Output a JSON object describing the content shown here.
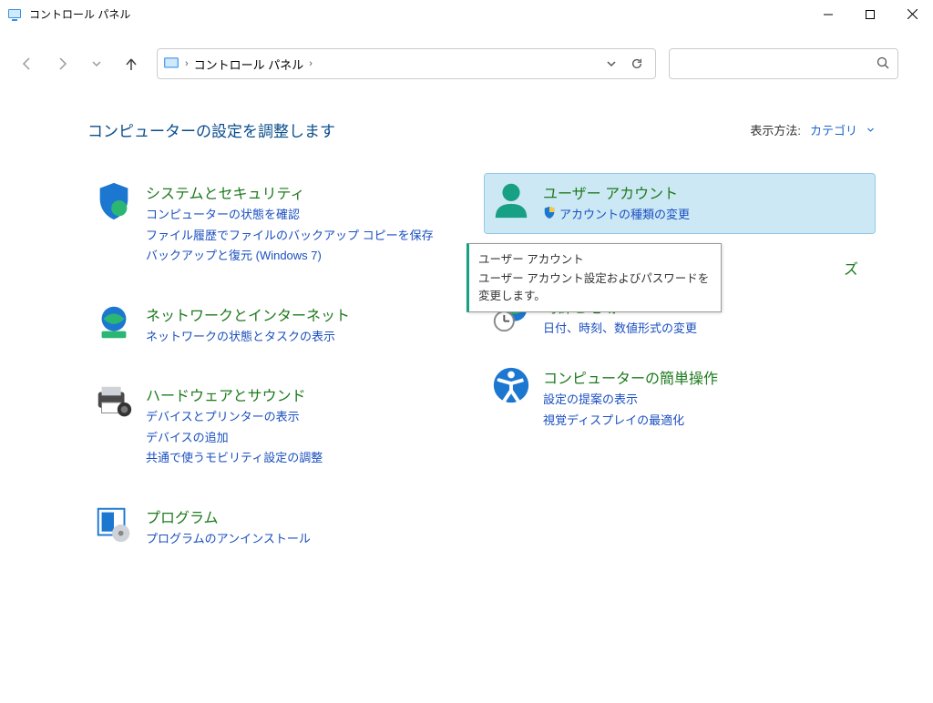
{
  "window": {
    "title": "コントロール パネル"
  },
  "breadcrumb": {
    "root": "コントロール パネル"
  },
  "heading": "コンピューターの設定を調整します",
  "viewby": {
    "label": "表示方法:",
    "value": "カテゴリ"
  },
  "left": [
    {
      "title": "システムとセキュリティ",
      "links": [
        "コンピューターの状態を確認",
        "ファイル履歴でファイルのバックアップ コピーを保存",
        "バックアップと復元 (Windows 7)"
      ]
    },
    {
      "title": "ネットワークとインターネット",
      "links": [
        "ネットワークの状態とタスクの表示"
      ]
    },
    {
      "title": "ハードウェアとサウンド",
      "links": [
        "デバイスとプリンターの表示",
        "デバイスの追加",
        "共通で使うモビリティ設定の調整"
      ]
    },
    {
      "title": "プログラム",
      "links": [
        "プログラムのアンインストール"
      ]
    }
  ],
  "right": [
    {
      "title": "ユーザー アカウント",
      "shield_link": "アカウントの種類の変更"
    },
    {
      "title_trail": "ズ"
    },
    {
      "title": "時計と地域",
      "links": [
        "日付、時刻、数値形式の変更"
      ]
    },
    {
      "title": "コンピューターの簡単操作",
      "links": [
        "設定の提案の表示",
        "視覚ディスプレイの最適化"
      ]
    }
  ],
  "tooltip": {
    "title": "ユーザー アカウント",
    "body": "ユーザー アカウント設定およびパスワードを変更します。"
  }
}
